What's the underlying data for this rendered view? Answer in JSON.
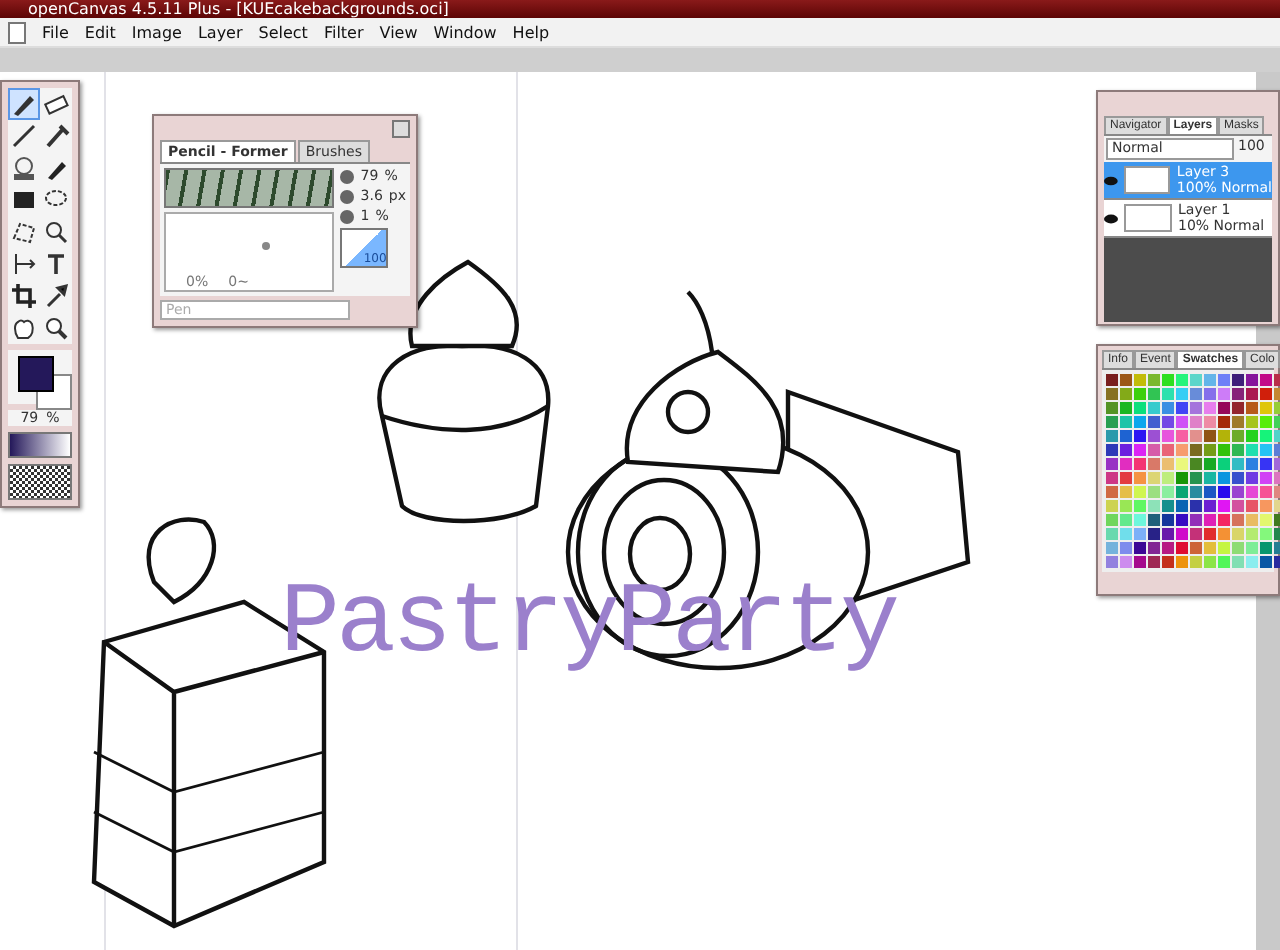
{
  "window": {
    "title": "openCanvas 4.5.11 Plus - [KUEcakebackgrounds.oci]"
  },
  "menu": [
    "File",
    "Edit",
    "Image",
    "Layer",
    "Select",
    "Filter",
    "View",
    "Window",
    "Help"
  ],
  "canvas": {
    "title_text": "PastryParty"
  },
  "toolbox": {
    "opacity": "79",
    "opacity_unit": "%"
  },
  "brush_panel": {
    "tabs": [
      {
        "label": "Pencil - Former",
        "selected": true
      },
      {
        "label": "Brushes",
        "selected": false
      }
    ],
    "settings": [
      {
        "value": "79",
        "unit": "%"
      },
      {
        "value": "3.6",
        "unit": "px"
      },
      {
        "value": "1",
        "unit": "%"
      }
    ],
    "preview_labels": [
      "0%",
      "0~"
    ],
    "pressure": "100",
    "name_field": {
      "placeholder": "Pen"
    }
  },
  "layers_panel": {
    "tabs": [
      {
        "label": "Navigator",
        "selected": false
      },
      {
        "label": "Layers",
        "selected": true
      },
      {
        "label": "Masks",
        "selected": false
      }
    ],
    "blend_mode": "Normal",
    "opacity": "100",
    "layers": [
      {
        "name": "Layer 3",
        "info": "100% Normal",
        "visible": true,
        "selected": true
      },
      {
        "name": "Layer 1",
        "info": "10% Normal",
        "visible": true,
        "selected": false
      }
    ]
  },
  "swatches_panel": {
    "tabs": [
      {
        "label": "Info",
        "selected": false
      },
      {
        "label": "Event",
        "selected": false
      },
      {
        "label": "Swatches",
        "selected": true
      },
      {
        "label": "Colo",
        "selected": false
      }
    ]
  }
}
